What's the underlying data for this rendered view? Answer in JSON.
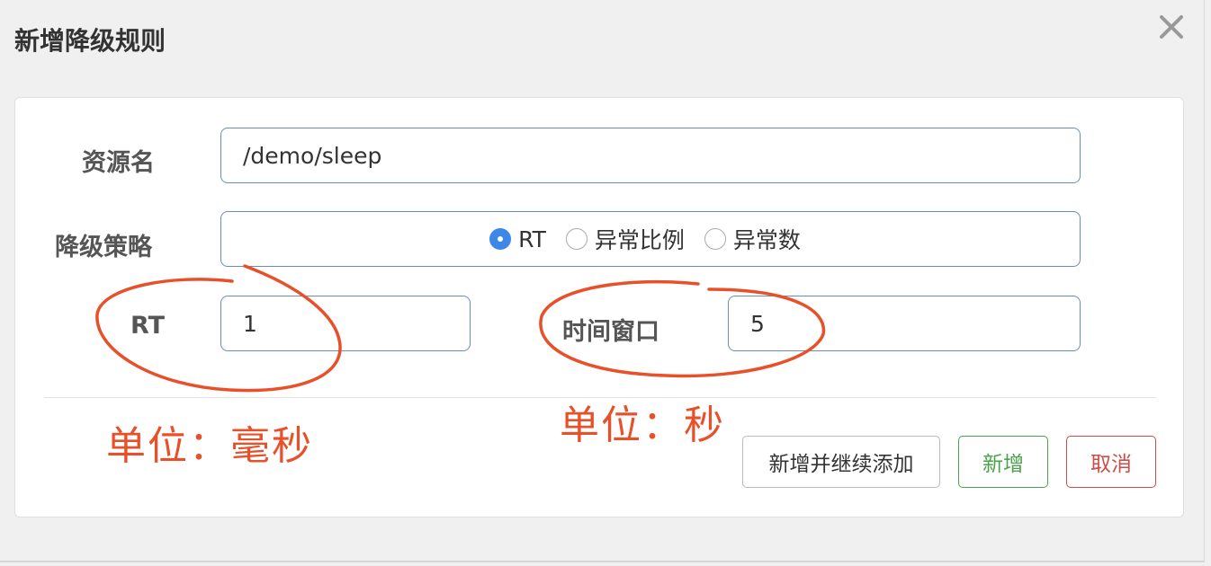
{
  "dialog": {
    "title": "新增降级规则",
    "close_icon": "close-icon"
  },
  "form": {
    "resource_label": "资源名",
    "resource_value": "/demo/sleep",
    "strategy_label": "降级策略",
    "strategy_options": [
      {
        "label": "RT",
        "selected": true
      },
      {
        "label": "异常比例",
        "selected": false
      },
      {
        "label": "异常数",
        "selected": false
      }
    ],
    "rt_label": "RT",
    "rt_value": "1",
    "window_label": "时间窗口",
    "window_value": "5"
  },
  "buttons": {
    "add_continue": "新增并继续添加",
    "add": "新增",
    "cancel": "取消"
  },
  "annotations": {
    "rt_unit": "单位：毫秒",
    "window_unit": "单位：秒",
    "color": "#e8502a"
  },
  "colors": {
    "accent": "#3d87e8",
    "success": "#4aa34a",
    "danger": "#d04a4a",
    "input_border": "#6b8cb7"
  }
}
